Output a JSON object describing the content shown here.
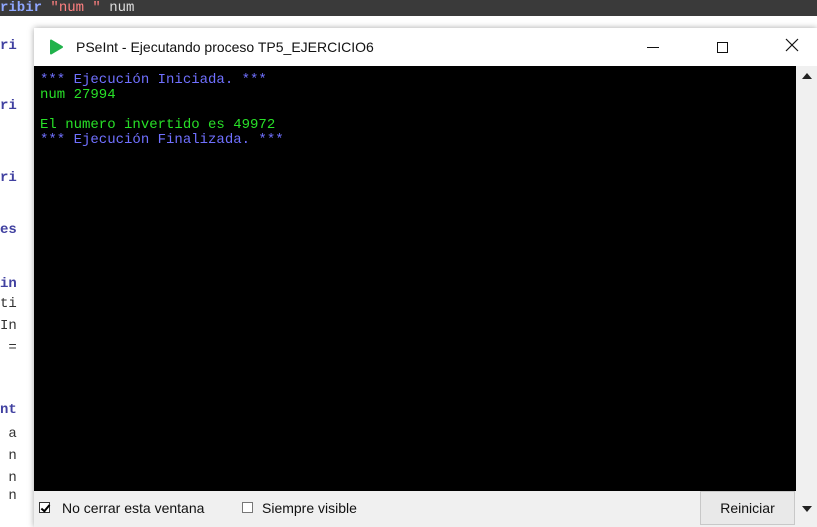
{
  "editor": {
    "top_line": {
      "kw": "ribir",
      "str": " \"num \"",
      "rest": " num"
    },
    "fragments": [
      "ri",
      "ri",
      "ri",
      "es",
      "in",
      "ti",
      "In",
      " =",
      "nt",
      " a",
      " n",
      " n",
      " n"
    ]
  },
  "window": {
    "title": "PSeInt - Ejecutando proceso TP5_EJERCICIO6",
    "icon": "pseint-play-icon"
  },
  "console": {
    "lines": [
      {
        "text": "*** Ejecución Iniciada. ***",
        "kind": "sys"
      },
      {
        "text": "num 27994",
        "kind": "out"
      },
      {
        "text": "",
        "kind": "out"
      },
      {
        "text": "El numero invertido es 49972",
        "kind": "out"
      },
      {
        "text": "*** Ejecución Finalizada. ***",
        "kind": "sys"
      }
    ]
  },
  "footer": {
    "no_close_label": "No cerrar esta ventana",
    "no_close_checked": true,
    "always_visible_label": "Siempre visible",
    "always_visible_checked": false,
    "restart_label": "Reiniciar"
  },
  "colors": {
    "console_bg": "#000000",
    "system_text": "#7070ff",
    "output_text": "#28e028",
    "icon_green": "#21b24b"
  }
}
